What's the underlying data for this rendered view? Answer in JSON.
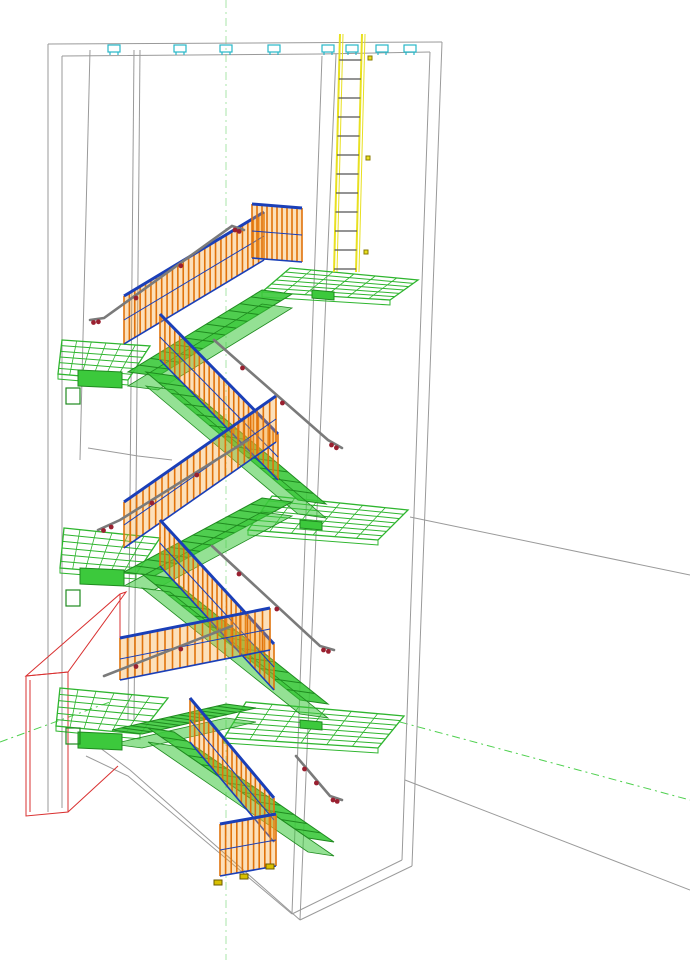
{
  "view": {
    "mode": "3d-wireframe-model",
    "background": "#ffffff"
  },
  "model": {
    "subject": "stair-tower",
    "flights": 5,
    "landings": 6,
    "has_roof_ladder": true,
    "has_handrails": true
  },
  "colors": {
    "stringer": "#3cc93c",
    "stringer_edge": "#1f8a1f",
    "landing_grating": "#2fb52f",
    "guard_rail": "#1a3fb8",
    "balusters": "#e0720a",
    "baluster_fill": "#f6a63a",
    "handrail": "#7a7a7a",
    "handrail_bracket": "#9a2030",
    "ladder": "#e8e020",
    "shaft_outline": "#9a9a9a",
    "roof_fittings": "#27b7c9",
    "guide_axis": "#4fd04f",
    "vertical_axis": "#a8e6a8",
    "adjacent_outline": "#d93030",
    "base_plate": "#d8c000"
  },
  "icons": {
    "ladder": "ladder-icon",
    "base_plate": "base-plate-icon"
  }
}
